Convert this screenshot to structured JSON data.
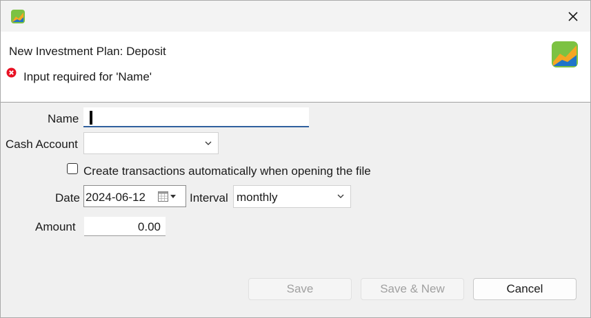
{
  "window": {
    "close_icon": "close-icon",
    "app_icon": "portfolio-performance-icon"
  },
  "header": {
    "title": "New Investment Plan: Deposit",
    "error_message": "Input required for 'Name'",
    "error_icon": "error-icon",
    "error_color": "#e81123"
  },
  "form": {
    "name_label": "Name",
    "name_value": "",
    "cash_account_label": "Cash Account",
    "cash_account_value": "",
    "auto_create_label": "Create transactions automatically when opening the file",
    "auto_create_checked": false,
    "date_label": "Date",
    "date_value": "2024-06-12",
    "interval_label": "Interval",
    "interval_value": "monthly",
    "amount_label": "Amount",
    "amount_value": "0.00"
  },
  "buttons": {
    "save": "Save",
    "save_new": "Save & New",
    "cancel": "Cancel"
  },
  "colors": {
    "accent": "#2f5f9e",
    "icon_green": "#7cc242",
    "icon_orange": "#f5a623",
    "icon_blue": "#1f74c9"
  }
}
